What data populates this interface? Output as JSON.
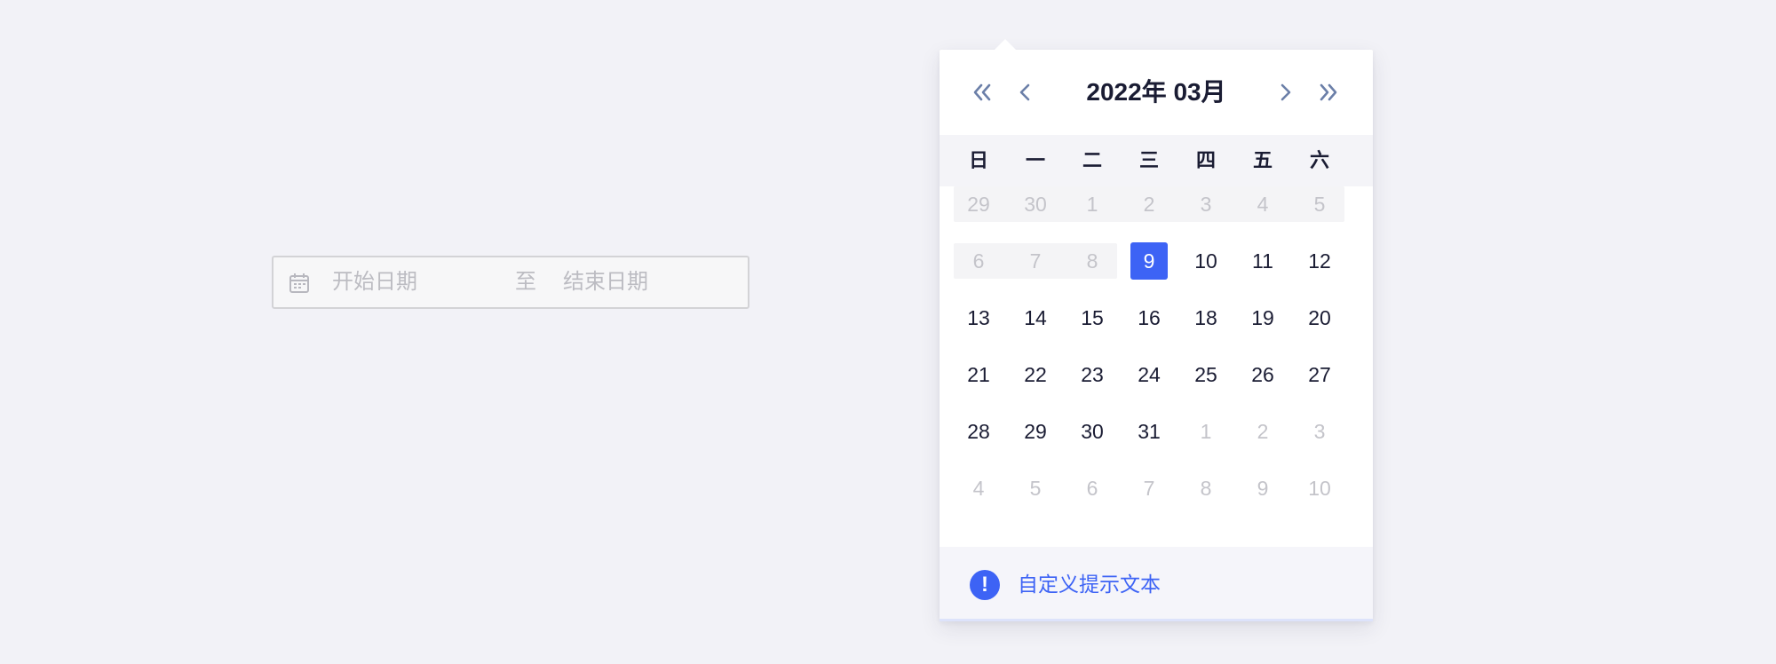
{
  "range_input": {
    "start_placeholder": "开始日期",
    "separator": "至",
    "end_placeholder": "结束日期"
  },
  "calendar": {
    "title": "2022年 03月",
    "weekdays": [
      "日",
      "一",
      "二",
      "三",
      "四",
      "五",
      "六"
    ],
    "weeks": [
      [
        {
          "d": "29",
          "dim": true
        },
        {
          "d": "30",
          "dim": true
        },
        {
          "d": "1",
          "dim": true
        },
        {
          "d": "2",
          "dim": true
        },
        {
          "d": "3",
          "dim": true
        },
        {
          "d": "4",
          "dim": true
        },
        {
          "d": "5",
          "dim": true
        }
      ],
      [
        {
          "d": "6",
          "dim": true
        },
        {
          "d": "7",
          "dim": true
        },
        {
          "d": "8",
          "dim": true
        },
        {
          "d": "9",
          "selected": true
        },
        {
          "d": "10"
        },
        {
          "d": "11"
        },
        {
          "d": "12"
        }
      ],
      [
        {
          "d": "13"
        },
        {
          "d": "14"
        },
        {
          "d": "15"
        },
        {
          "d": "16"
        },
        {
          "d": "18"
        },
        {
          "d": "19"
        },
        {
          "d": "20"
        }
      ],
      [
        {
          "d": "21"
        },
        {
          "d": "22"
        },
        {
          "d": "23"
        },
        {
          "d": "24"
        },
        {
          "d": "25"
        },
        {
          "d": "26"
        },
        {
          "d": "27"
        }
      ],
      [
        {
          "d": "28"
        },
        {
          "d": "29"
        },
        {
          "d": "30"
        },
        {
          "d": "31"
        },
        {
          "d": "1",
          "dim": true
        },
        {
          "d": "2",
          "dim": true
        },
        {
          "d": "3",
          "dim": true
        }
      ],
      [
        {
          "d": "4",
          "dim": true
        },
        {
          "d": "5",
          "dim": true
        },
        {
          "d": "6",
          "dim": true
        },
        {
          "d": "7",
          "dim": true
        },
        {
          "d": "8",
          "dim": true
        },
        {
          "d": "9",
          "dim": true
        },
        {
          "d": "10",
          "dim": true
        }
      ]
    ],
    "disabled_bands": [
      {
        "week": 0,
        "from": 0,
        "to": 6
      },
      {
        "week": 1,
        "from": 0,
        "to": 2
      }
    ],
    "footer_tip": "自定义提示文本",
    "footer_icon": "!",
    "accent_color": "#3d63f5",
    "icons": [
      "calendar-icon",
      "double-chevron-left-icon",
      "chevron-left-icon",
      "chevron-right-icon",
      "double-chevron-right-icon",
      "alert-icon"
    ]
  }
}
